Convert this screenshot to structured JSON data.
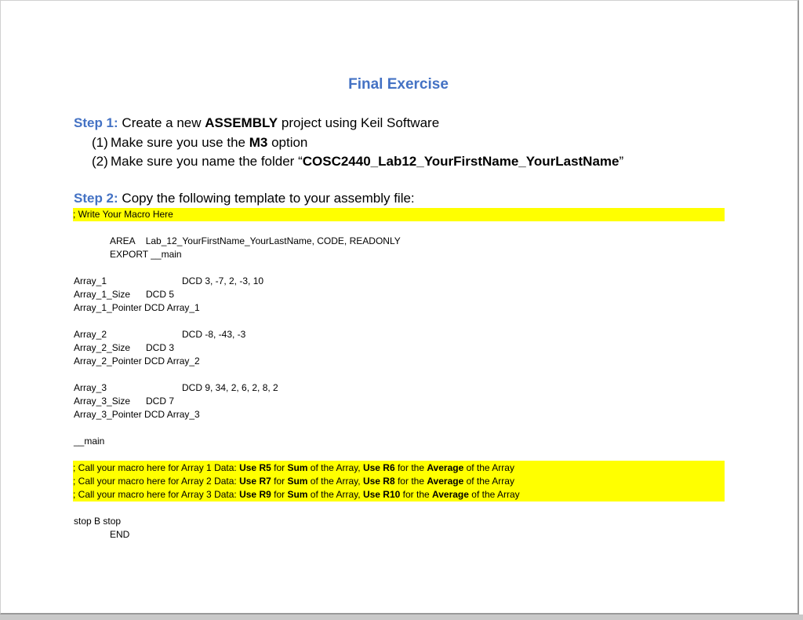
{
  "title": "Final Exercise",
  "step1": {
    "label": "Step 1:",
    "text_a": " Create a new ",
    "bold": "ASSEMBLY",
    "text_b": " project using Keil Software",
    "items": [
      {
        "num": "(1)",
        "text_a": "Make sure you use the ",
        "bold": "M3",
        "text_b": " option"
      },
      {
        "num": "(2)",
        "text_a": "Make sure you name the folder “",
        "bold": "COSC2440_Lab12_YourFirstName_YourLastName",
        "text_b": "”"
      }
    ]
  },
  "step2": {
    "label": "Step 2:",
    "text": " Copy the following template to your assembly file:"
  },
  "code": {
    "macro_comment": "; Write Your Macro Here",
    "area_kw": "AREA",
    "area_args": "Lab_12_YourFirstName_YourLastName, CODE, READONLY",
    "export_line": "EXPORT __main",
    "arrays": [
      {
        "name": "Array_1",
        "data": "DCD 3, -7, 2, -3, 10",
        "size_label": "Array_1_Size",
        "size_val": "DCD 5",
        "pointer_line": "Array_1_Pointer DCD Array_1"
      },
      {
        "name": "Array_2",
        "data": "DCD -8, -43, -3",
        "size_label": "Array_2_Size",
        "size_val": "DCD 3",
        "pointer_line": "Array_2_Pointer DCD Array_2"
      },
      {
        "name": "Array_3",
        "data": "DCD 9, 34, 2, 6, 2, 8, 2",
        "size_label": "Array_3_Size",
        "size_val": "DCD 7",
        "pointer_line": "Array_3_Pointer DCD Array_3"
      }
    ],
    "main_label": "__main",
    "calls": [
      {
        "a": "; Call your macro here for Array 1 Data: ",
        "use_sum": "Use R5",
        "for1": " for ",
        "sum": "Sum",
        "mid": " of the Array, ",
        "use_avg": "Use R6",
        "for2": " for the ",
        "avg": "Average",
        "end": " of the Array"
      },
      {
        "a": "; Call your macro here for Array 2 Data: ",
        "use_sum": "Use R7",
        "for1": " for ",
        "sum": "Sum",
        "mid": " of the Array, ",
        "use_avg": "Use R8",
        "for2": " for the ",
        "avg": "Average",
        "end": " of the Array"
      },
      {
        "a": "; Call your macro here for Array 3 Data: ",
        "use_sum": "Use R9",
        "for1": " for ",
        "sum": "Sum",
        "mid": " of the Array, ",
        "use_avg": "Use R10",
        "for2": " for the ",
        "avg": "Average",
        "end": " of the Array"
      }
    ],
    "stop_line": "stop B stop",
    "end_line": "END"
  }
}
